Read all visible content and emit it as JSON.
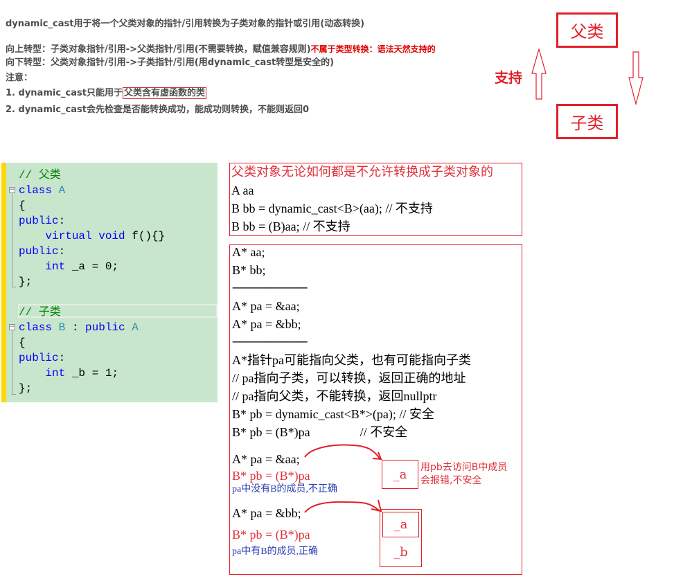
{
  "notes": {
    "title": "dynamic_cast用于将一个父类对象的指针/引用转换为子类对象的指针或引用(动态转换)",
    "upcast": "向上转型：子类对象指针/引用->父类指针/引用(不需要转换，赋值兼容规则)",
    "upcast_note": "不属于类型转换：语法天然支持的",
    "downcast": "向下转型：父类对象指针/引用->子类指针/引用(用dynamic_cast转型是安全的)",
    "attention": "注意：",
    "rule1_prefix": "1. dynamic_cast只能用于",
    "rule1_boxed": "父类含有虚函数的类",
    "rule2": "2. dynamic_cast会先检查是否能转换成功，能成功则转换，不能则返回0"
  },
  "diagram": {
    "parent_label": "父类",
    "child_label": "子类",
    "support_label": "支持",
    "color": "#e0202a"
  },
  "code": {
    "lines": [
      {
        "cm": "// 父类"
      },
      {
        "kw": "class",
        "ty": "A"
      },
      {
        "plain": "{"
      },
      {
        "kw": "public",
        "plain": ":"
      },
      {
        "kw": "virtual void",
        "plain": "f(){}"
      },
      {
        "kw": "public",
        "plain": ":"
      },
      {
        "kw": "int",
        "plain": "_a = 0;"
      },
      {
        "plain": "};"
      },
      {
        "cm": "// 子类"
      },
      {
        "kw": "class",
        "ty": "B",
        "kw2": "public",
        "ty2": "A"
      },
      {
        "plain": "{"
      },
      {
        "kw": "public",
        "plain": ":"
      },
      {
        "kw": "int",
        "plain": "_b = 1;"
      },
      {
        "plain": "};"
      }
    ]
  },
  "box1": {
    "heading": "父类对象无论如何都是不允许转换成子类对象的",
    "lines": [
      "A aa",
      "B bb = dynamic_cast<B>(aa); // 不支持",
      "B bb = (B)aa; // 不支持"
    ]
  },
  "box2": {
    "lines": [
      "A* aa;",
      "B* bb;",
      "------------------------",
      "A* pa = &aa;",
      "A* pa = &bb;",
      "------------------------",
      "A*指针pa可能指向父类，也有可能指向子类",
      "// pa指向子类，可以转换，返回正确的地址",
      "// pa指向父类，不能转换，返回nullptr",
      "B* pb = dynamic_cast<B*>(pa); // 安全",
      "B* pb = (B*)pa                // 不安全"
    ],
    "example1": {
      "assign": "A* pa = &aa;",
      "cast": "B* pb = (B*)pa",
      "note": "pa中没有B的成员,不正确",
      "member_a": "_a",
      "warning_line1": "用pb去访问B中成员",
      "warning_line2": "会报错,不安全"
    },
    "example2": {
      "assign": "A* pa = &bb;",
      "cast": "B* pb = (B*)pa",
      "note": "pa中有B的成员,正确",
      "member_a": "_a",
      "member_b": "_b"
    }
  }
}
